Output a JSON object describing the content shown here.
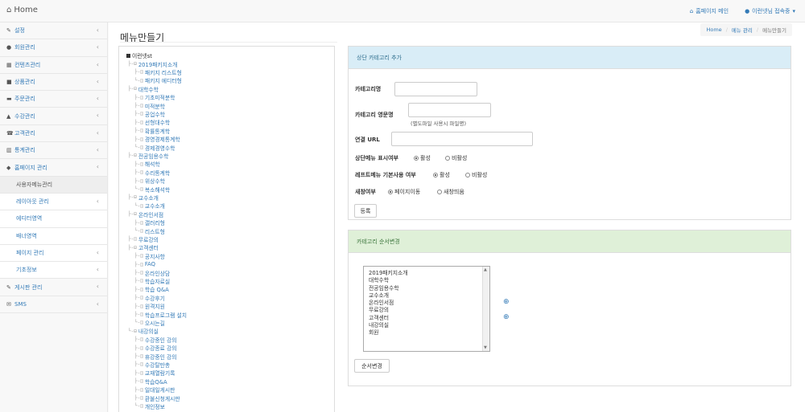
{
  "navbar": {
    "brand": "Home",
    "home_link": "홈페이지 메인",
    "user_link": "이런넷님 접속중"
  },
  "sidebar": {
    "items": [
      {
        "label": "설정",
        "icon": "wrench-icon",
        "glyph": "✎",
        "has_chevron": true
      },
      {
        "label": "회원관리",
        "icon": "user-icon",
        "glyph": "●",
        "has_chevron": true
      },
      {
        "label": "컨텐츠관리",
        "icon": "grid-icon",
        "glyph": "▦",
        "has_chevron": true
      },
      {
        "label": "상품관리",
        "icon": "gift-icon",
        "glyph": "■",
        "has_chevron": true
      },
      {
        "label": "주문관리",
        "icon": "cart-icon",
        "glyph": "▬",
        "has_chevron": true
      },
      {
        "label": "수강관리",
        "icon": "graduation-cap-icon",
        "glyph": "▲",
        "has_chevron": true
      },
      {
        "label": "고객관리",
        "icon": "phone-icon",
        "glyph": "☎",
        "has_chevron": true
      },
      {
        "label": "통계관리",
        "icon": "bar-chart-icon",
        "glyph": "▥",
        "has_chevron": true
      },
      {
        "label": "홈페이지 관리",
        "icon": "sitemap-icon",
        "glyph": "◆",
        "has_chevron": true
      },
      {
        "label": "사용자메뉴관리",
        "sub": true,
        "active": true
      },
      {
        "label": "레이아웃 관리",
        "sub": true,
        "has_chevron": true
      },
      {
        "label": "에디터영역",
        "sub": true
      },
      {
        "label": "배너영역",
        "sub": true
      },
      {
        "label": "페이지 관리",
        "sub": true,
        "has_chevron": true
      },
      {
        "label": "기초정보",
        "sub": true,
        "has_chevron": true
      },
      {
        "label": "게시판 관리",
        "icon": "edit-icon",
        "glyph": "✎",
        "has_chevron": true
      },
      {
        "label": "SMS",
        "icon": "envelope-icon",
        "glyph": "✉",
        "has_chevron": true
      }
    ]
  },
  "page": {
    "title": "메뉴만들기",
    "breadcrumb": [
      "Home",
      "메뉴 관리",
      "메뉴만들기"
    ]
  },
  "tree": {
    "root": "이런넷st",
    "items": [
      {
        "label": "2019패키지소개",
        "level": 1,
        "conn": "├-⊟"
      },
      {
        "label": "패키지 리스트형",
        "level": 2,
        "conn": "├-◫"
      },
      {
        "label": "패키지 에디터형",
        "level": 2,
        "conn": "└-◫"
      },
      {
        "label": "대학수학",
        "level": 1,
        "conn": "├-⊟"
      },
      {
        "label": "기초미적분학",
        "level": 2,
        "conn": "├-◫"
      },
      {
        "label": "미적분학",
        "level": 2,
        "conn": "├-◫"
      },
      {
        "label": "공업수학",
        "level": 2,
        "conn": "├-◫"
      },
      {
        "label": "선형대수학",
        "level": 2,
        "conn": "├-◫"
      },
      {
        "label": "확률통계학",
        "level": 2,
        "conn": "├-◫"
      },
      {
        "label": "경영경제통계학",
        "level": 2,
        "conn": "├-◫"
      },
      {
        "label": "경제경영수학",
        "level": 2,
        "conn": "└-◫"
      },
      {
        "label": "전공임용수학",
        "level": 1,
        "conn": "├-⊟"
      },
      {
        "label": "해석학",
        "level": 2,
        "conn": "├-◫"
      },
      {
        "label": "수리통계학",
        "level": 2,
        "conn": "├-◫"
      },
      {
        "label": "위상수학",
        "level": 2,
        "conn": "├-◫"
      },
      {
        "label": "복소해석학",
        "level": 2,
        "conn": "└-◫"
      },
      {
        "label": "교수소개",
        "level": 1,
        "conn": "├-⊟"
      },
      {
        "label": "교수소개",
        "level": 2,
        "conn": "└-◫"
      },
      {
        "label": "온라인서점",
        "level": 1,
        "conn": "├-⊟"
      },
      {
        "label": "갤러리형",
        "level": 2,
        "conn": "├-◫"
      },
      {
        "label": "리스트형",
        "level": 2,
        "conn": "└-◫"
      },
      {
        "label": "무료강의",
        "level": 1,
        "conn": "├-◫"
      },
      {
        "label": "고객센터",
        "level": 1,
        "conn": "├-⊟"
      },
      {
        "label": "공지사항",
        "level": 2,
        "conn": "├-◫"
      },
      {
        "label": "FAQ",
        "level": 2,
        "conn": "├-◫"
      },
      {
        "label": "온라인상담",
        "level": 2,
        "conn": "├-◫"
      },
      {
        "label": "학습자료실",
        "level": 2,
        "conn": "├-◫"
      },
      {
        "label": "학습 Q&A",
        "level": 2,
        "conn": "├-◫"
      },
      {
        "label": "수강후기",
        "level": 2,
        "conn": "├-◫"
      },
      {
        "label": "원격지원",
        "level": 2,
        "conn": "├-◫"
      },
      {
        "label": "학습프로그램 설치",
        "level": 2,
        "conn": "├-◫"
      },
      {
        "label": "오시는길",
        "level": 2,
        "conn": "└-◫"
      },
      {
        "label": "내강의실",
        "level": 1,
        "conn": "└-⊟"
      },
      {
        "label": "수강중인 강의",
        "level": 2,
        "conn": "├-◫"
      },
      {
        "label": "수강종료 강의",
        "level": 2,
        "conn": "├-◫"
      },
      {
        "label": "휴강중인 강의",
        "level": 2,
        "conn": "├-◫"
      },
      {
        "label": "수강탈만총",
        "level": 2,
        "conn": "├-◫"
      },
      {
        "label": "교재열람기록",
        "level": 2,
        "conn": "├-◫"
      },
      {
        "label": "학습Q&A",
        "level": 2,
        "conn": "├-◫"
      },
      {
        "label": "일대일게시판",
        "level": 2,
        "conn": "├-◫"
      },
      {
        "label": "환불신청게시판",
        "level": 2,
        "conn": "├-◫"
      },
      {
        "label": "개인정보",
        "level": 2,
        "conn": "└-◫"
      }
    ]
  },
  "add_panel": {
    "heading": "상단 카테고리 추가",
    "name_label": "카테고리명",
    "name_value": "",
    "eng_label": "카테고리 영문명",
    "eng_value": "",
    "eng_help": "(별도파일 사용시 파일명)",
    "url_label": "연결 URL",
    "url_value": "",
    "top_menu_label": "상단메뉴 표시여부",
    "top_menu_options": [
      "활성",
      "비활성"
    ],
    "left_menu_label": "레프트메뉴 기본사용 여부",
    "left_menu_options": [
      "활성",
      "비활성"
    ],
    "new_window_label": "새창여부",
    "new_window_options": [
      "페이지이동",
      "새창띄움"
    ],
    "submit_label": "등록"
  },
  "order_panel": {
    "heading": "카테고리 순서변경",
    "options": [
      "2019패키지소개",
      "대학수학",
      "전공임용수학",
      "교수소개",
      "온라인서점",
      "무료강의",
      "고객센터",
      "내강의실",
      "회원"
    ],
    "submit_label": "순서변경"
  }
}
